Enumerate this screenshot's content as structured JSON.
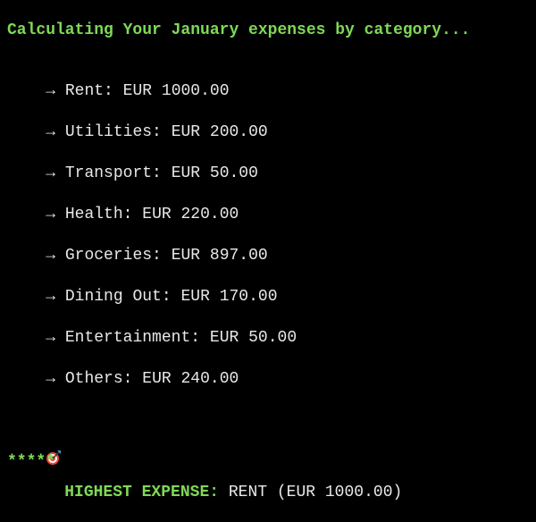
{
  "terminal": {
    "heading": "Calculating Your January expenses by category...",
    "arrow_glyph": "→",
    "currency": "EUR",
    "categories": [
      {
        "label": "Rent:",
        "amount": "1000.00"
      },
      {
        "label": "Utilities:",
        "amount": "200.00"
      },
      {
        "label": "Transport:",
        "amount": "50.00"
      },
      {
        "label": "Health:",
        "amount": "220.00"
      },
      {
        "label": "Groceries:",
        "amount": "897.00"
      },
      {
        "label": "Dining Out:",
        "amount": "170.00"
      },
      {
        "label": "Entertainment:",
        "amount": "50.00"
      },
      {
        "label": "Others:",
        "amount": "240.00"
      }
    ],
    "highest": {
      "icon": "target-icon",
      "label": "HIGHEST EXPENSE:",
      "value": "RENT (EUR 1000.00)"
    },
    "footer_stars": "*****"
  },
  "colors": {
    "background": "#000000",
    "text": "#e8e8e8",
    "accent_green": "#7ed957"
  }
}
